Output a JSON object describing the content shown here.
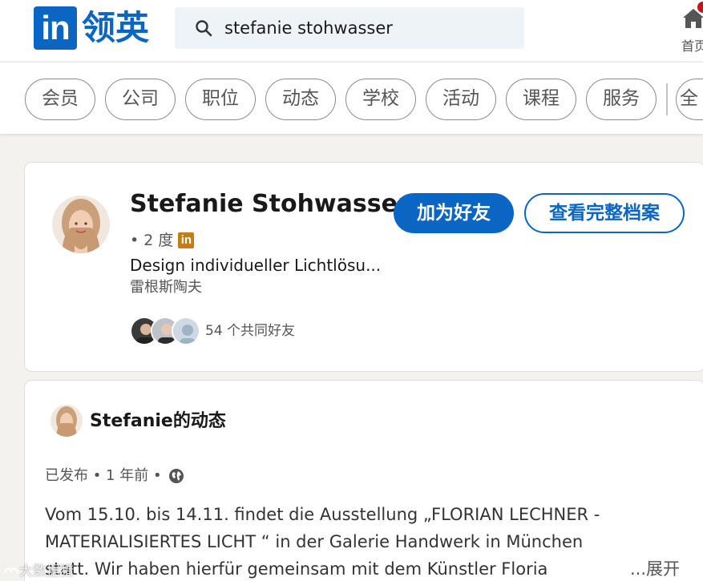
{
  "header": {
    "logo_text": "in",
    "logo_name": "领英",
    "search_value": "stefanie stohwasser",
    "home_label": "首页"
  },
  "filters": [
    "会员",
    "公司",
    "职位",
    "动态",
    "学校",
    "活动",
    "课程",
    "服务",
    "全"
  ],
  "profile": {
    "name": "Stefanie Stohwasser",
    "degree": "• 2 度",
    "badge": "in",
    "headline": "Design individueller Lichtlösu...",
    "location": "雷根斯陶夫",
    "mutual_connections": "54 个共同好友",
    "connect_button": "加为好友",
    "view_profile_button": "查看完整档案"
  },
  "activity": {
    "title": "Stefanie的动态",
    "posted_meta": "已发布 • 1 年前 •",
    "post_lines": [
      "Vom 15.10. bis 14.11. findet die Ausstellung „FLORIAN LECHNER - ",
      "MATERIALISIERTES LICHT  “ in der Galerie Handwerk in München",
      "statt.      Wir haben hierfür gemeinsam mit dem Künstler Floria"
    ],
    "more_label": " ...展开"
  },
  "watermark": "大数据猎",
  "colors": {
    "brand": "#0a66c2",
    "page_bg": "#f3f2ef",
    "badge_gold": "#c37d16"
  }
}
